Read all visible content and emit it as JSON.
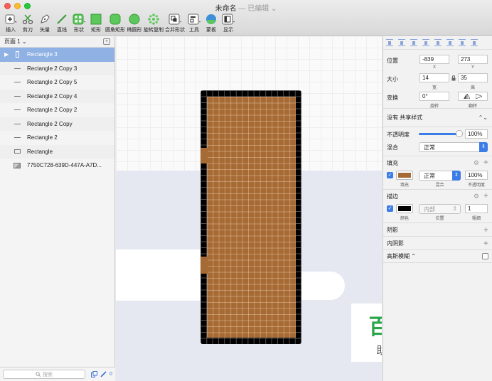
{
  "window": {
    "title": "未命名",
    "status": "— 已编辑 ⌄"
  },
  "toolbar": [
    {
      "id": "insert",
      "label": "插入",
      "icon": "plus-icon"
    },
    {
      "id": "scissors",
      "label": "剪刀",
      "icon": "scissors-icon"
    },
    {
      "id": "vector",
      "label": "矢量",
      "icon": "pen-icon"
    },
    {
      "id": "line",
      "label": "直线",
      "icon": "line-icon"
    },
    {
      "id": "shape",
      "label": "形状",
      "icon": "shape-grid-icon"
    },
    {
      "id": "rect",
      "label": "矩形",
      "icon": "rectangle-icon"
    },
    {
      "id": "round-rect",
      "label": "圆角矩形",
      "icon": "rounded-rectangle-icon"
    },
    {
      "id": "oval",
      "label": "椭圆形",
      "icon": "oval-icon"
    },
    {
      "id": "rotate-copy",
      "label": "旋转复制",
      "icon": "rotate-copy-icon"
    },
    {
      "id": "combine",
      "label": "合并形状",
      "icon": "combine-icon"
    },
    {
      "id": "tools",
      "label": "工具",
      "icon": "tools-icon"
    },
    {
      "id": "artboard",
      "label": "蒙板",
      "icon": "mask-icon"
    },
    {
      "id": "view",
      "label": "显示",
      "icon": "view-icon"
    }
  ],
  "layers_panel": {
    "page": "页面 1 ⌄",
    "layers": [
      {
        "name": "Rectangle 3",
        "kind": "vrect",
        "selected": true
      },
      {
        "name": "Rectangle 2 Copy 3",
        "kind": "line"
      },
      {
        "name": "Rectangle 2 Copy 5",
        "kind": "line"
      },
      {
        "name": "Rectangle 2 Copy 4",
        "kind": "line"
      },
      {
        "name": "Rectangle 2 Copy 2",
        "kind": "line"
      },
      {
        "name": "Rectangle 2 Copy",
        "kind": "line"
      },
      {
        "name": "Rectangle 2",
        "kind": "line"
      },
      {
        "name": "Rectangle",
        "kind": "rect"
      },
      {
        "name": "7750C728-639D-447A-A7D...",
        "kind": "img"
      }
    ],
    "search_placeholder": "搜索",
    "edit_count": "0"
  },
  "watermark": {
    "main": "百科全说",
    "sub": "助你轻松解决"
  },
  "inspector": {
    "position": {
      "label": "位置",
      "x": "-839",
      "y": "273",
      "x_label": "X",
      "y_label": "Y"
    },
    "size": {
      "label": "大小",
      "w": "14",
      "h": "35",
      "w_label": "宽",
      "h_label": "高"
    },
    "transform": {
      "label": "变换",
      "rotation": "0°",
      "rotation_label": "旋转",
      "flip_label": "翻转"
    },
    "shared_style": "没有 共享样式",
    "opacity": {
      "label": "不透明度",
      "value": "100%",
      "level": 0.9
    },
    "blend": {
      "label": "混合",
      "value": "正常"
    },
    "fill": {
      "title": "填充",
      "color": "#a66a35",
      "blend": "正常",
      "opacity": "100%",
      "color_label": "填充",
      "blend_label": "混合",
      "opacity_label": "不透明度"
    },
    "border": {
      "title": "描边",
      "color": "#000000",
      "position": "内部",
      "width": "1",
      "color_label": "颜色",
      "position_label": "位置",
      "width_label": "粗细"
    },
    "shadow": "阴影",
    "inner_shadow": "内阴影",
    "blur": "高斯模糊 ⌃"
  }
}
